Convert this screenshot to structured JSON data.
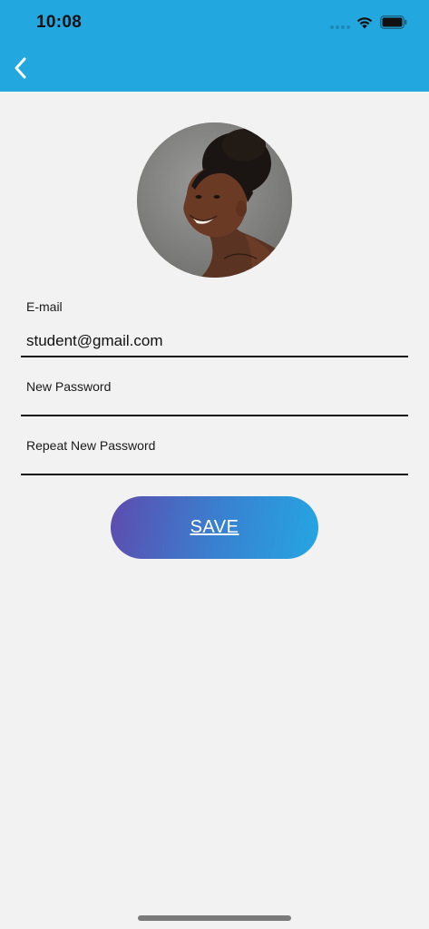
{
  "status_bar": {
    "time": "10:08",
    "icons": [
      "cellular-signal-icon",
      "wifi-icon",
      "battery-icon"
    ]
  },
  "header": {
    "back_icon": "chevron-left-icon",
    "background_color": "#22a7df"
  },
  "profile": {
    "avatar": "profile-photo"
  },
  "form": {
    "email": {
      "label": "E-mail",
      "value": "student@gmail.com",
      "placeholder": ""
    },
    "new_password": {
      "label": "New Password",
      "value": "",
      "placeholder": ""
    },
    "repeat_password": {
      "label": "Repeat New Password",
      "value": "",
      "placeholder": ""
    }
  },
  "actions": {
    "save_label": "SAVE",
    "save_gradient": [
      "#5e4bae",
      "#25a6e2"
    ]
  },
  "colors": {
    "background": "#f2f2f2",
    "accent": "#22a7df"
  }
}
